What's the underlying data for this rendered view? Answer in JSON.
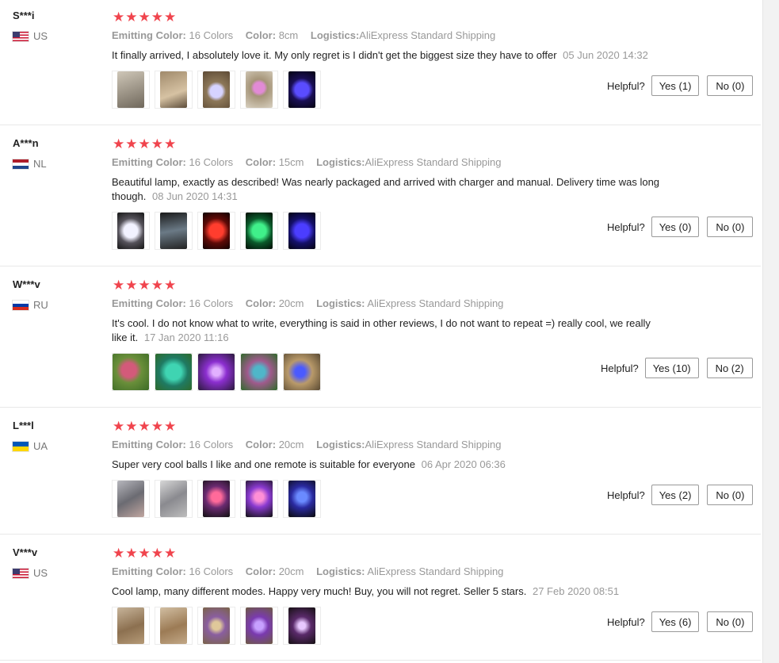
{
  "labels": {
    "emitting_color": "Emitting Color:",
    "color": "Color:",
    "logistics": "Logistics:",
    "helpful": "Helpful?",
    "stars": "★★★★★"
  },
  "colors": {
    "star": "#f0444d",
    "muted": "#999999",
    "border": "#e8e8e8"
  },
  "reviews": [
    {
      "user": "S***i",
      "country": "US",
      "flag": "us",
      "emitting_color": "16 Colors",
      "color": "8cm",
      "logistics": "AliExpress Standard Shipping",
      "text": "It finally arrived, I absolutely love it. My only regret is I didn't get the biggest size they have to offer",
      "date": "05 Jun 2020 14:32",
      "yes": "Yes (1)",
      "no": "No (0)",
      "rating": 5,
      "photos": [
        "lamp-box-photo",
        "package-photo",
        "box-open-photo",
        "lamp-pink-photo",
        "lamp-blue-photo"
      ]
    },
    {
      "user": "A***n",
      "country": "NL",
      "flag": "nl",
      "emitting_color": "16 Colors",
      "color": "15cm",
      "logistics": "AliExpress Standard Shipping",
      "text": "Beautiful lamp, exactly as described! Was nearly packaged and arrived with charger and manual. Delivery time was long though.",
      "date": "08 Jun 2020 14:31",
      "yes": "Yes (0)",
      "no": "No (0)",
      "rating": 5,
      "photos": [
        "lamp-white-photo",
        "remote-photo",
        "lamp-red-photo",
        "lamp-green-photo",
        "lamp-blue-photo"
      ]
    },
    {
      "user": "W***v",
      "country": "RU",
      "flag": "ru",
      "emitting_color": "16 Colors",
      "color": "20cm",
      "logistics": "AliExpress Standard Shipping",
      "text": "It's cool. I do not know what to write, everything is said in other reviews, I do not want to repeat =) really cool, we really like it.",
      "date": "17 Jan 2020 11:16",
      "yes": "Yes (10)",
      "no": "No (2)",
      "rating": 5,
      "photos": [
        "lamp-pink-grass-photo",
        "lamp-teal-photo",
        "lamp-purple-photo",
        "lamp-galaxy-photo",
        "lamp-room-photo"
      ]
    },
    {
      "user": "L***l",
      "country": "UA",
      "flag": "ua",
      "emitting_color": "16 Colors",
      "color": "20cm",
      "logistics": "AliExpress Standard Shipping",
      "text": "Super very cool balls I like and one remote is suitable for everyone",
      "date": "06 Apr 2020 06:36",
      "yes": "Yes (2)",
      "no": "No (0)",
      "rating": 5,
      "photos": [
        "package-gray-photo",
        "package-clear-photo",
        "lamp-red-galaxy-photo",
        "lamp-pink-galaxy-photo",
        "lamp-blue-galaxy-photo"
      ]
    },
    {
      "user": "V***v",
      "country": "US",
      "flag": "us",
      "emitting_color": "16 Colors",
      "color": "20cm",
      "logistics": "AliExpress Standard Shipping",
      "text": "Cool lamp, many different modes. Happy very much! Buy, you will not regret. Seller 5 stars.",
      "date": "27 Feb 2020 08:51",
      "yes": "Yes (6)",
      "no": "No (0)",
      "rating": 5,
      "photos": [
        "box-brown-photo",
        "box-lamp-photo",
        "lamp-gold-photo",
        "lamp-violet-photo",
        "lamp-moon-photo"
      ]
    }
  ]
}
